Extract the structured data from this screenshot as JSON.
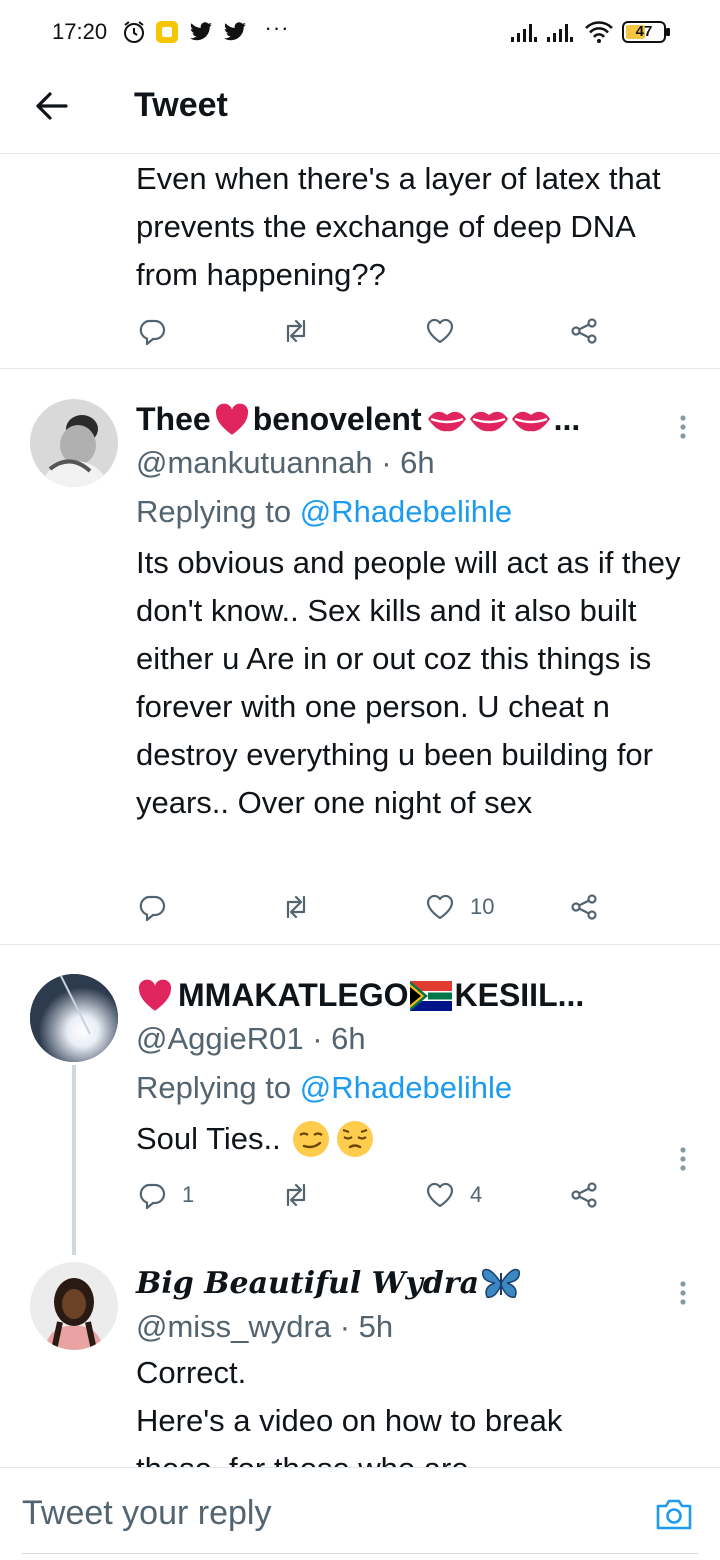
{
  "status_bar": {
    "time": "17:20",
    "battery": "47",
    "battery_level": 0.47,
    "icons": [
      "alarm-icon",
      "app-notification-icon",
      "twitter-icon",
      "twitter-icon",
      "more-dots-icon",
      "signal-icon",
      "signal-icon",
      "wifi-icon",
      "battery-icon"
    ],
    "more": "···"
  },
  "header": {
    "title": "Tweet",
    "back_icon": "arrow-left-icon"
  },
  "tweets": [
    {
      "text": "Even when there's a layer of latex that prevents the exchange of deep DNA from happening??",
      "replies": "",
      "likes": ""
    },
    {
      "name_part1": "Thee",
      "name_part2": "benovelent",
      "name_suffix": "...",
      "handle": "@mankutuannah",
      "time": "· 6h",
      "replying_to_label": "Replying to",
      "replying_to": "@Rhadebelihle",
      "text": "Its obvious and people will act as if they don't know.. Sex kills and it also built either u Are in or out coz this things is forever with one person. U cheat n destroy everything u been building for years.. Over one night of sex",
      "replies": "",
      "likes": "10"
    },
    {
      "name": "MMAKATLEGO",
      "name_part2": "KESIIL...",
      "handle": "@AggieR01",
      "time": "· 6h",
      "replying_to_label": "Replying to",
      "replying_to": "@Rhadebelihle",
      "text": "Soul Ties..",
      "replies": "1",
      "likes": "4"
    },
    {
      "name": "𝑩𝒊𝒈 𝑩𝒆𝒂𝒖𝒕𝒊𝒇𝒖𝒍 𝑾𝒚𝒅𝒓𝒂",
      "handle": "@miss_wydra",
      "time": "· 5h",
      "text_line1": "Correct.",
      "text_line2": "Here's a video on how to break",
      "text_line3": "these, for those who are"
    }
  ],
  "composer": {
    "placeholder": "Tweet your reply",
    "camera_icon": "camera-icon"
  },
  "colors": {
    "accent": "#1d9bf0",
    "text": "#0f1419",
    "secondary": "#536471",
    "divider": "#e1e8ed",
    "heart_red": "#e0245e"
  }
}
